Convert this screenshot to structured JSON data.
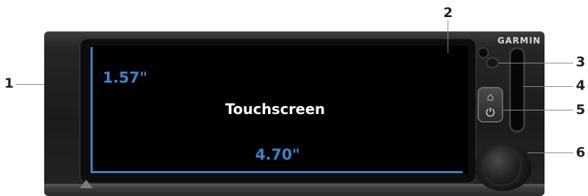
{
  "brand": "GARMIN",
  "screen_label": "Touchscreen",
  "dimensions": {
    "height": "1.57\"",
    "width": "4.70\""
  },
  "callouts": [
    "1",
    "2",
    "3",
    "4",
    "5",
    "6"
  ],
  "icons": {
    "home_button": "home-power-icon"
  },
  "colors": {
    "dimension": "#3b84c8",
    "bezel": "#1b1b1b",
    "screen": "#000000"
  }
}
